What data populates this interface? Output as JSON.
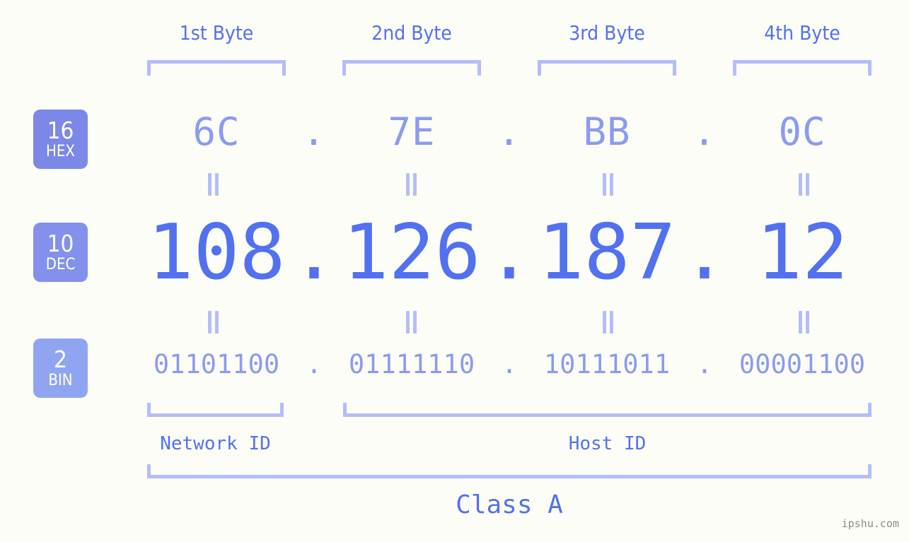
{
  "background_color": "#fdfdf8",
  "accent_color": "#5271f0",
  "accent_light_color": "#8b9bf0",
  "bracket_color": "#b3bdfb",
  "byte_headers": [
    {
      "label": "1st Byte"
    },
    {
      "label": "2nd Byte"
    },
    {
      "label": "3rd Byte"
    },
    {
      "label": "4th Byte"
    }
  ],
  "bases": [
    {
      "number": "16",
      "name": "HEX",
      "color": "#7b88e8"
    },
    {
      "number": "10",
      "name": "DEC",
      "color": "#8391ec"
    },
    {
      "number": "2",
      "name": "BIN",
      "color": "#90a5f2"
    }
  ],
  "separator": ".",
  "equals_symbol": "=",
  "rows": {
    "hex": {
      "octets": [
        "6C",
        "7E",
        "BB",
        "0C"
      ]
    },
    "dec": {
      "octets": [
        "108",
        "126",
        "187",
        "12"
      ]
    },
    "bin": {
      "octets": [
        "01101100",
        "01111110",
        "10111011",
        "00001100"
      ]
    }
  },
  "segments": {
    "network_id": "Network ID",
    "host_id": "Host ID",
    "class": "Class A"
  },
  "watermark": "ipshu.com"
}
